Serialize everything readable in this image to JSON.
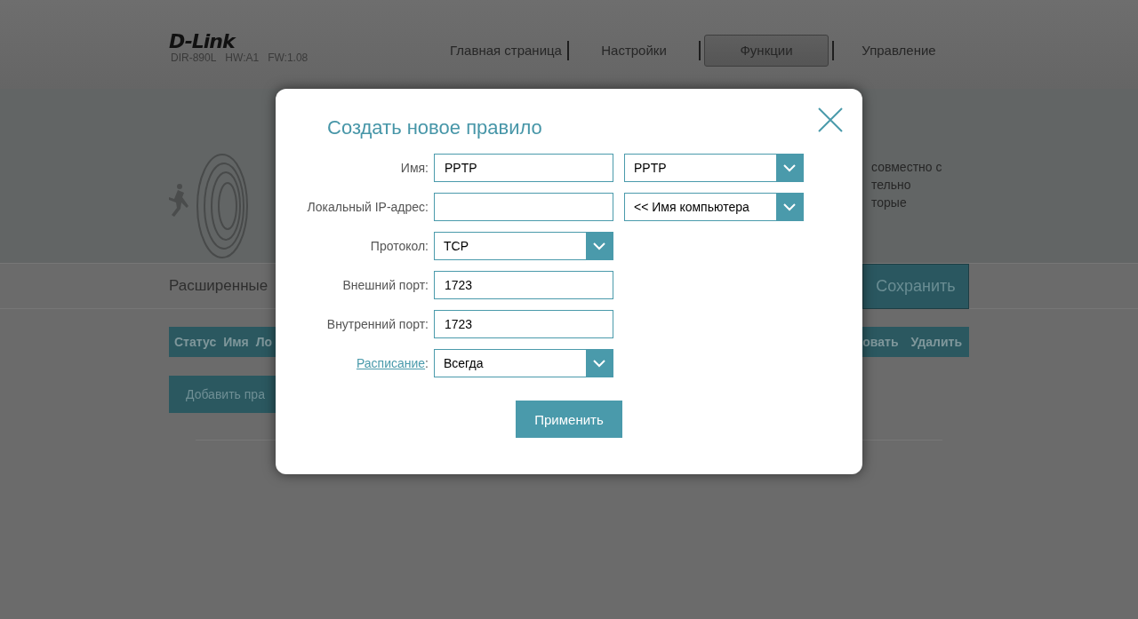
{
  "header": {
    "logo": "D-Link",
    "model": "DIR-890L",
    "hw": "HW:A1",
    "fw": "FW:1.08"
  },
  "nav": [
    {
      "label": "Главная страница",
      "selected": false
    },
    {
      "label": "Настройки",
      "selected": false
    },
    {
      "label": "Функции",
      "selected": true
    },
    {
      "label": "Управление",
      "selected": false
    }
  ],
  "banner": {
    "text_lines": [
      "совместно с",
      "тельно",
      "торые"
    ]
  },
  "section": {
    "title": "Расширенные",
    "save_button": "Сохранить"
  },
  "table": {
    "columns_left": [
      "Статус",
      "Имя",
      "Ло"
    ],
    "columns_right": [
      "овать",
      "Удалить"
    ]
  },
  "add_button": "Добавить пра",
  "dialog": {
    "title": "Создать новое правило",
    "rows": [
      {
        "label": "Имя:",
        "link": false,
        "field": {
          "kind": "text",
          "value": "PPTP"
        },
        "extra": {
          "kind": "select",
          "value": "PPTP"
        }
      },
      {
        "label": "Локальный IP-адрес:",
        "link": false,
        "field": {
          "kind": "text"
        },
        "extra": {
          "kind": "select",
          "value": "<< Имя компьютера"
        }
      },
      {
        "label": "Протокол:",
        "link": false,
        "field": {
          "kind": "select",
          "value": "TCP"
        }
      },
      {
        "label": "Внешний порт:",
        "link": false,
        "field": {
          "kind": "text",
          "value": "1723"
        }
      },
      {
        "label": "Внутренний порт:",
        "link": false,
        "field": {
          "kind": "text",
          "value": "1723"
        }
      },
      {
        "label": "Расписание",
        "link": true,
        "suffix": ":",
        "field": {
          "kind": "select",
          "value": "Всегда"
        }
      }
    ],
    "apply_button": "Применить"
  }
}
